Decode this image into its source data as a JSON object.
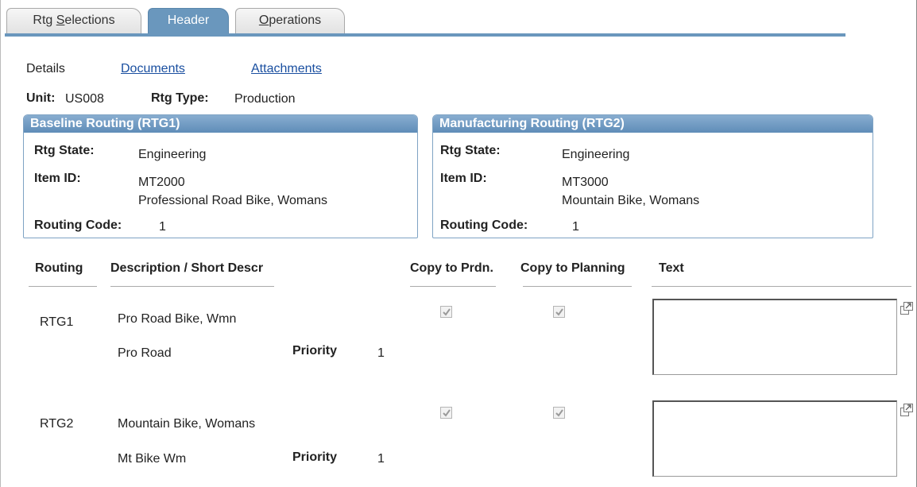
{
  "tabs": {
    "rtg_selections_pre": "Rtg ",
    "rtg_selections_u": "S",
    "rtg_selections_post": "elections",
    "header": "Header",
    "operations_u": "O",
    "operations_post": "perations"
  },
  "subnav": {
    "details": "Details",
    "documents": "Documents",
    "attachments": "Attachments"
  },
  "unit_row": {
    "unit_label": "Unit:",
    "unit_value": "US008",
    "rtg_type_label": "Rtg Type:",
    "rtg_type_value": "Production"
  },
  "baseline": {
    "title": "Baseline Routing (RTG1)",
    "rtg_state_label": "Rtg State:",
    "rtg_state_value": "Engineering",
    "item_id_label": "Item ID:",
    "item_id_value": "MT2000",
    "item_desc": "Professional Road Bike, Womans",
    "routing_code_label": "Routing Code:",
    "routing_code_value": "1"
  },
  "manufacturing": {
    "title": "Manufacturing Routing (RTG2)",
    "rtg_state_label": "Rtg State:",
    "rtg_state_value": "Engineering",
    "item_id_label": "Item ID:",
    "item_id_value": "MT3000",
    "item_desc": "Mountain Bike, Womans",
    "routing_code_label": "Routing Code:",
    "routing_code_value": "1"
  },
  "grid": {
    "headers": {
      "routing": "Routing",
      "description": "Description / Short Descr",
      "copy_prdn": "Copy to Prdn.",
      "copy_planning": "Copy to Planning",
      "text": "Text"
    },
    "priority_label": "Priority",
    "rows": [
      {
        "routing": "RTG1",
        "description": "Pro Road Bike, Wmn",
        "short_descr": "Pro Road",
        "priority": "1",
        "copy_prdn": true,
        "copy_planning": true,
        "text": ""
      },
      {
        "routing": "RTG2",
        "description": "Mountain Bike, Womans",
        "short_descr": "Mt Bike Wm",
        "priority": "1",
        "copy_prdn": true,
        "copy_planning": true,
        "text": ""
      }
    ]
  },
  "colors": {
    "accent": "#6a97bd",
    "link": "#1a4fa0",
    "group_header": "#6f9ac2"
  },
  "icons": {
    "expand": "expand-textbox-icon",
    "checkbox": "checkbox-checked-disabled"
  }
}
